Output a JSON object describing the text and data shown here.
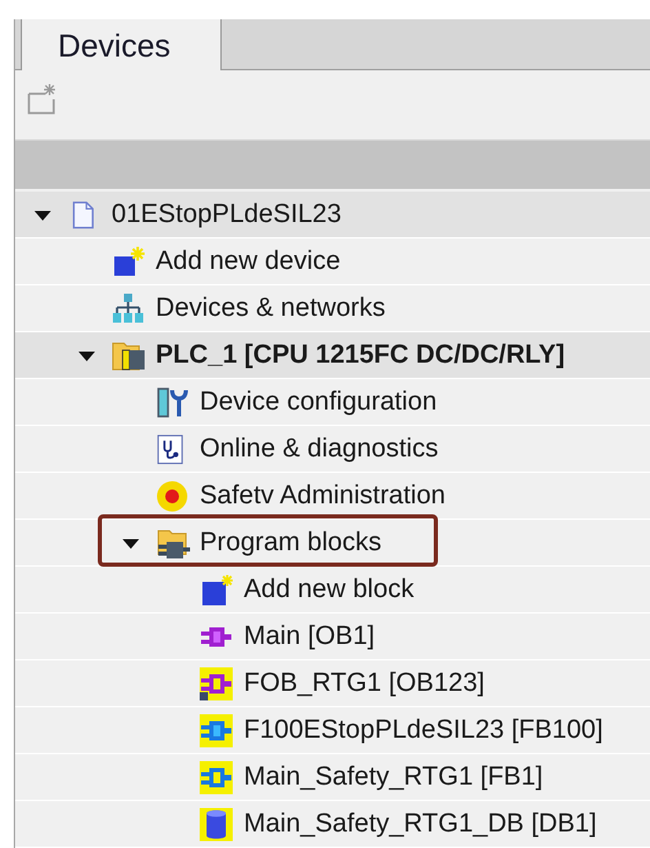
{
  "tabs": [
    {
      "label": "Devices",
      "selected": true
    }
  ],
  "tree": [
    {
      "label": "01EStopPLdeSIL23",
      "kind": "project",
      "shaded": true,
      "expanded": true,
      "children": [
        {
          "label": "Add new device",
          "kind": "add-device",
          "shaded": false
        },
        {
          "label": "Devices & networks",
          "kind": "network",
          "shaded": false
        },
        {
          "label": "PLC_1 [CPU 1215FC DC/DC/RLY]",
          "kind": "plc",
          "shaded": true,
          "bold": true,
          "expanded": true,
          "children": [
            {
              "label": "Device configuration",
              "kind": "device-config",
              "shaded": false
            },
            {
              "label": "Online & diagnostics",
              "kind": "diagnostics",
              "shaded": false
            },
            {
              "label": "Safetv Administration",
              "kind": "safety",
              "shaded": false
            },
            {
              "label": "Program blocks",
              "kind": "block-folder",
              "shaded": false,
              "outlined": true,
              "expanded": true,
              "children": [
                {
                  "label": "Add new block",
                  "kind": "add-block",
                  "shaded": false
                },
                {
                  "label": "Main [OB1]",
                  "kind": "ob",
                  "shaded": false
                },
                {
                  "label": "FOB_RTG1 [OB123]",
                  "kind": "fob",
                  "shaded": false
                },
                {
                  "label": "F100EStopPLdeSIL23 [FB100]",
                  "kind": "ffb",
                  "shaded": false
                },
                {
                  "label": "Main_Safety_RTG1 [FB1]",
                  "kind": "ffb-yellow",
                  "shaded": false
                },
                {
                  "label": "Main_Safety_RTG1_DB [DB1]",
                  "kind": "db",
                  "shaded": false
                }
              ]
            }
          ]
        }
      ]
    }
  ]
}
